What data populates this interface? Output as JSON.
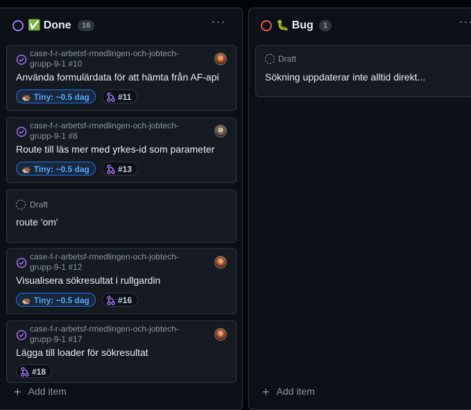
{
  "columns": [
    {
      "emoji": "✅",
      "title": "Done",
      "count": "16",
      "status_color": "#a371f7",
      "add_item_label": "Add item",
      "cards": [
        {
          "kind": "issue",
          "repo": "case-f-r-arbetsf-rmedlingen-och-jobtech-grupp-9-1 #10",
          "title": "Använda formulärdata för att hämta från AF-api",
          "size": "Tiny: ~0.5 dag",
          "size_emoji": "🦔",
          "pr": "#11",
          "avatar": "avatar-a"
        },
        {
          "kind": "issue",
          "repo": "case-f-r-arbetsf-rmedlingen-och-jobtech-grupp-9-1 #8",
          "title": "Route till läs mer med yrkes-id som parameter",
          "size": "Tiny: ~0.5 dag",
          "size_emoji": "🦔",
          "pr": "#13",
          "avatar": "avatar-b"
        },
        {
          "kind": "draft",
          "draft_label": "Draft",
          "title": "route 'om'"
        },
        {
          "kind": "issue",
          "repo": "case-f-r-arbetsf-rmedlingen-och-jobtech-grupp-9-1 #12",
          "title": "Visualisera sökresultat i rullgardin",
          "size": "Tiny: ~0.5 dag",
          "size_emoji": "🦔",
          "pr": "#16",
          "avatar": "avatar-a"
        },
        {
          "kind": "issue",
          "repo": "case-f-r-arbetsf-rmedlingen-och-jobtech-grupp-9-1 #17",
          "title": "Lägga till loader för sökresultat",
          "pr": "#18",
          "avatar": "avatar-a"
        }
      ]
    },
    {
      "emoji": "🐛",
      "title": "Bug",
      "count": "1",
      "status_color": "#f85149",
      "add_item_label": "Add item",
      "cards": [
        {
          "kind": "draft",
          "draft_label": "Draft",
          "title": "Sökning uppdaterar inte alltid direkt..."
        }
      ]
    }
  ]
}
